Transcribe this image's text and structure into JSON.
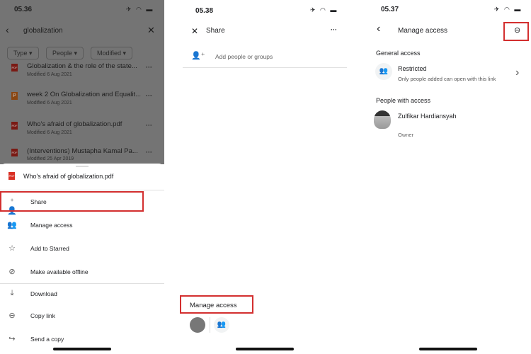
{
  "screen1": {
    "time": "05.36",
    "search": "globalization",
    "filters": [
      "Type",
      "People",
      "Modified"
    ],
    "files": [
      {
        "name": "Globalization & the role of the state...",
        "modified": "Modified 6 Aug 2021",
        "type": "PDF"
      },
      {
        "name": "week 2 On Globalization and Equalit...",
        "modified": "Modified 6 Aug 2021",
        "type": "P"
      },
      {
        "name": "Who's afraid of globalization.pdf",
        "modified": "Modified 6 Aug 2021",
        "type": "PDF"
      },
      {
        "name": "(Interventions) Mustapha Kamal Pa...",
        "modified": "Modified 25 Apr 2019",
        "type": "PDF"
      }
    ],
    "sheet_title": "Who's afraid of globalization.pdf",
    "menu": [
      {
        "label": "Share",
        "icon": "person-add-icon"
      },
      {
        "label": "Manage access",
        "icon": "people-icon"
      },
      {
        "label": "Add to Starred",
        "icon": "star-icon"
      },
      {
        "label": "Make available offline",
        "icon": "offline-icon"
      },
      {
        "label": "Download",
        "icon": "download-icon"
      },
      {
        "label": "Copy link",
        "icon": "link-icon"
      },
      {
        "label": "Send a copy",
        "icon": "send-icon"
      }
    ]
  },
  "screen2": {
    "time": "05.38",
    "title": "Share",
    "add_placeholder": "Add people or groups",
    "manage_access": "Manage access"
  },
  "screen3": {
    "time": "05.37",
    "title": "Manage access",
    "general_access": "General access",
    "restriction": "Restricted",
    "restriction_desc": "Only people added can open with this link",
    "people_with_access": "People with access",
    "person_name": "Zulfikar Hardiansyah",
    "person_role": "Owner"
  },
  "highlight_color": "#d32f2f"
}
